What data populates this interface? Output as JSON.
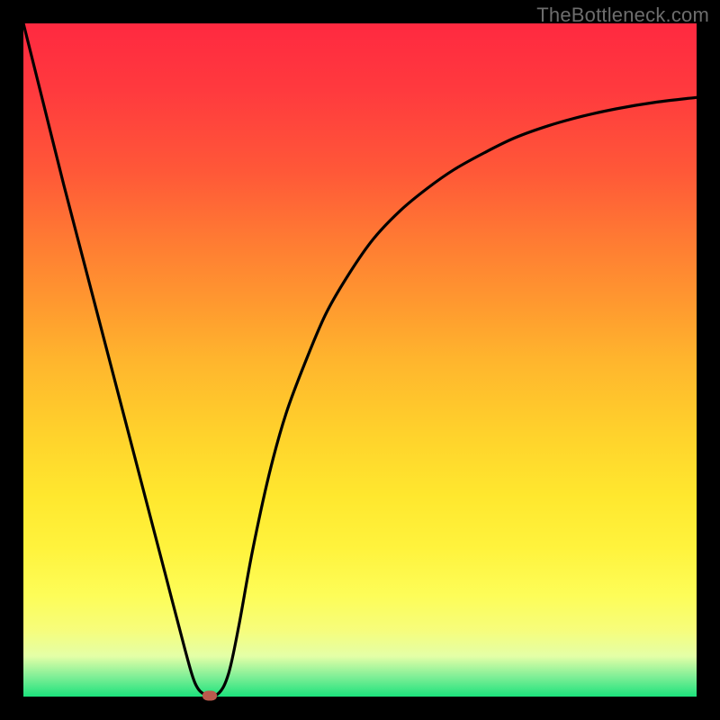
{
  "watermark": "TheBottleneck.com",
  "colors": {
    "frame_border": "#000000",
    "curve_stroke": "#000000",
    "marker_fill": "#bb5a4d",
    "gradient_top": "#ff2940",
    "gradient_bottom": "#1ce27c"
  },
  "chart_data": {
    "type": "line",
    "title": "",
    "xlabel": "",
    "ylabel": "",
    "xlim": [
      0,
      100
    ],
    "ylim": [
      0,
      100
    ],
    "grid": false,
    "legend": false,
    "series": [
      {
        "name": "bottleneck-curve",
        "x": [
          0.0,
          3.0,
          6.0,
          9.0,
          12.0,
          15.0,
          18.0,
          21.0,
          24.0,
          25.5,
          27.0,
          29.0,
          30.5,
          32.0,
          34.0,
          36.5,
          39.0,
          42.0,
          45.0,
          48.5,
          52.0,
          56.0,
          60.0,
          64.0,
          68.5,
          73.0,
          78.0,
          83.0,
          88.0,
          94.0,
          100.0
        ],
        "values": [
          100.0,
          88.0,
          76.0,
          64.5,
          53.0,
          41.5,
          30.0,
          18.5,
          7.0,
          2.0,
          0.3,
          0.5,
          3.5,
          10.5,
          21.5,
          33.0,
          42.0,
          50.0,
          57.0,
          63.0,
          68.0,
          72.2,
          75.5,
          78.3,
          80.8,
          83.0,
          84.8,
          86.2,
          87.3,
          88.3,
          89.0
        ]
      }
    ],
    "annotations": [
      {
        "name": "minimum-marker",
        "x": 27.7,
        "y": 0.2
      }
    ]
  }
}
